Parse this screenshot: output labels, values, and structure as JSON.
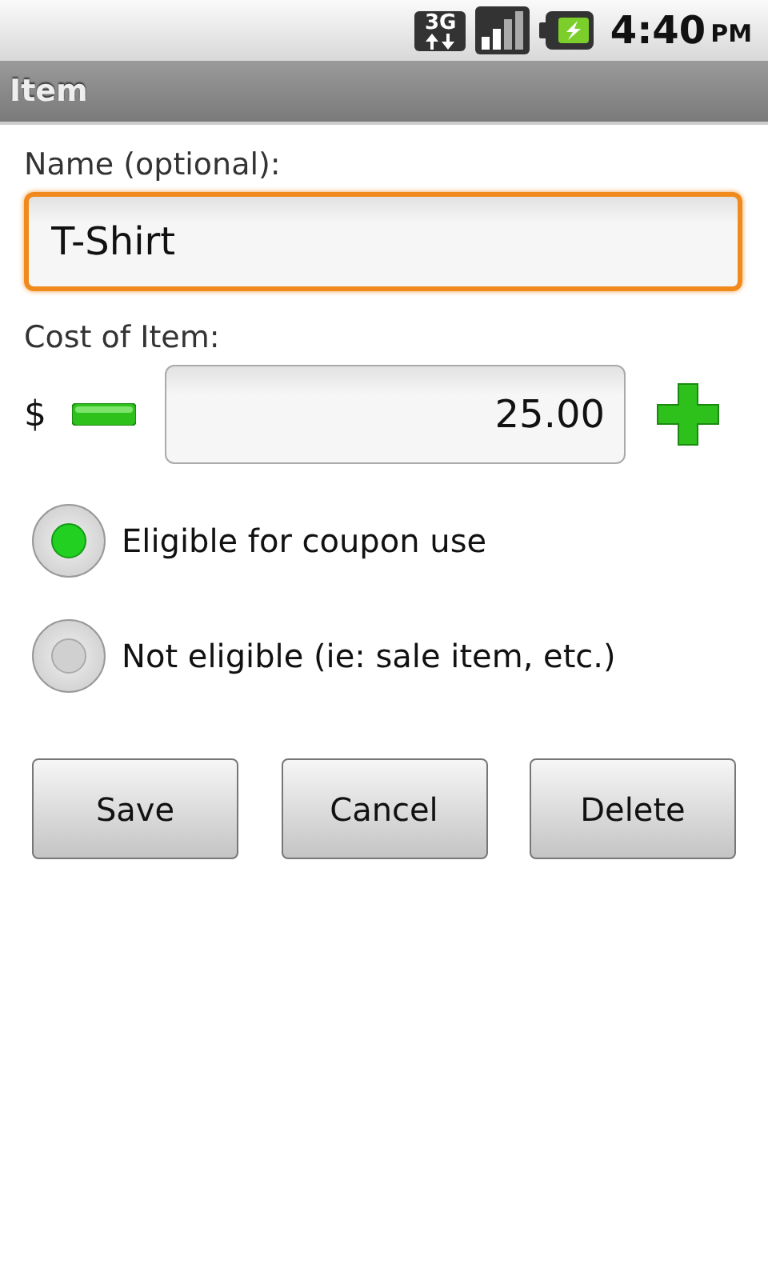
{
  "status_bar": {
    "network": "3G",
    "time": "4:40",
    "period": "PM"
  },
  "title": "Item",
  "name_field": {
    "label": "Name (optional):",
    "value": "T-Shirt",
    "focused": true
  },
  "cost": {
    "label": "Cost of Item:",
    "currency": "$",
    "value": "25.00"
  },
  "options": [
    {
      "label": "Eligible for coupon use",
      "selected": true
    },
    {
      "label": "Not eligible (ie: sale item, etc.)",
      "selected": false
    }
  ],
  "buttons": [
    "Save",
    "Cancel",
    "Delete"
  ]
}
